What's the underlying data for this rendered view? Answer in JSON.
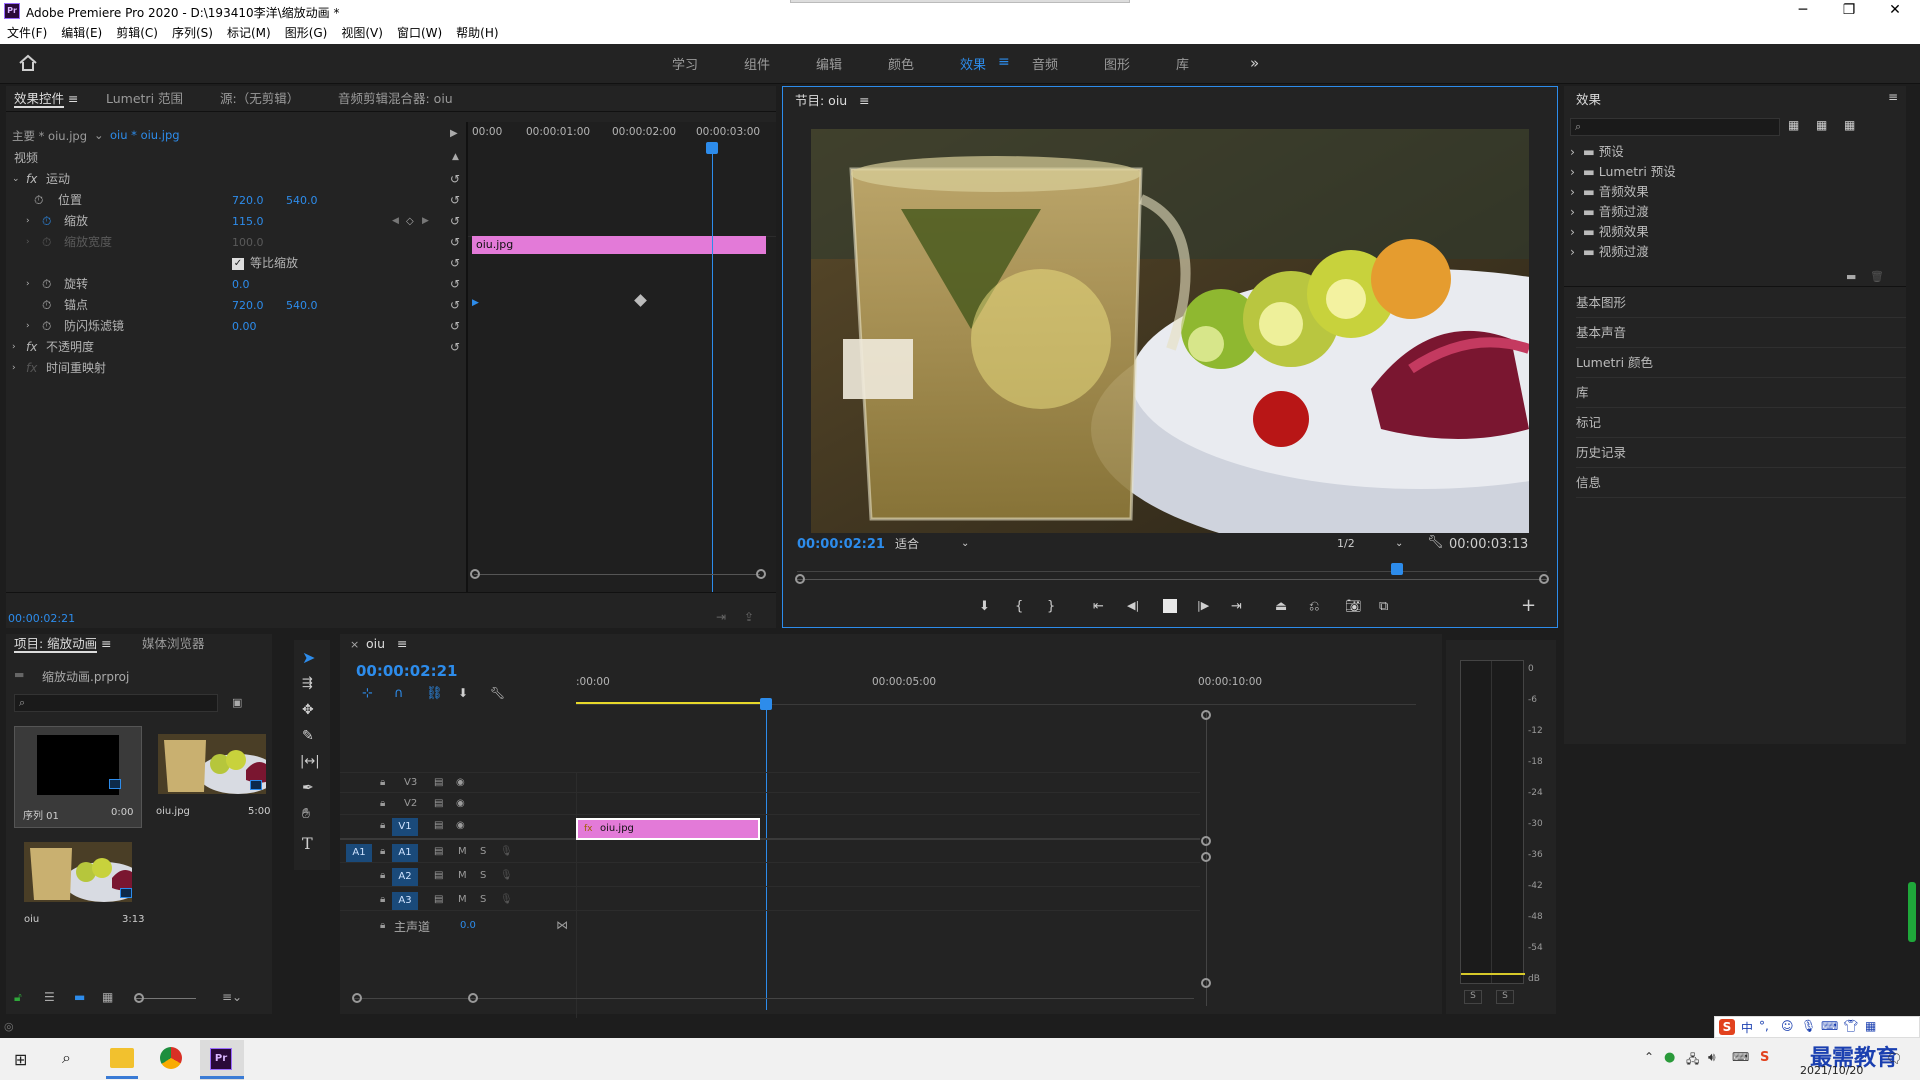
{
  "app": {
    "title": "Adobe Premiere Pro 2020 - D:\\193410李洋\\缩放动画 *",
    "icon": "Pr"
  },
  "menu": [
    "文件(F)",
    "编辑(E)",
    "剪辑(C)",
    "序列(S)",
    "标记(M)",
    "图形(G)",
    "视图(V)",
    "窗口(W)",
    "帮助(H)"
  ],
  "workspaces": [
    "学习",
    "组件",
    "编辑",
    "颜色",
    "效果",
    "音频",
    "图形",
    "库"
  ],
  "effect_controls": {
    "tabs": [
      "效果控件",
      "Lumetri 范围",
      "源:（无剪辑）",
      "音频剪辑混合器: oiu"
    ],
    "master": "主要 * oiu.jpg",
    "clip": "oiu * oiu.jpg",
    "video_label": "视频",
    "ruler": [
      "00:00",
      "00:00:01:00",
      "00:00:02:00",
      "00:00:03:00"
    ],
    "clip_bar": "oiu.jpg",
    "motion": "运动",
    "position": {
      "label": "位置",
      "x": "720.0",
      "y": "540.0"
    },
    "scale": {
      "label": "缩放",
      "value": "115.0"
    },
    "scale_width": {
      "label": "缩放宽度",
      "value": "100.0"
    },
    "uniform": "等比缩放",
    "rotation": {
      "label": "旋转",
      "value": "0.0"
    },
    "anchor": {
      "label": "锚点",
      "x": "720.0",
      "y": "540.0"
    },
    "flicker": {
      "label": "防闪烁滤镜",
      "value": "0.00"
    },
    "opacity": "不透明度",
    "timeremap": "时间重映射",
    "timecode": "00:00:02:21"
  },
  "program": {
    "tab": "节目: oiu",
    "timecode": "00:00:02:21",
    "fit": "适合",
    "res": "1/2",
    "duration": "00:00:03:13"
  },
  "effects": {
    "title": "效果",
    "tree": [
      "预设",
      "Lumetri 预设",
      "音频效果",
      "音频过渡",
      "视频效果",
      "视频过渡"
    ],
    "panels": [
      "基本图形",
      "基本声音",
      "Lumetri 颜色",
      "库",
      "标记",
      "历史记录",
      "信息"
    ]
  },
  "project": {
    "tabs": [
      "项目: 缩放动画",
      "媒体浏览器"
    ],
    "file": "缩放动画.prproj",
    "items": [
      {
        "name": "序列 01",
        "dur": "0:00"
      },
      {
        "name": "oiu.jpg",
        "dur": "5:00"
      },
      {
        "name": "oiu",
        "dur": "3:13"
      }
    ]
  },
  "timeline": {
    "tab": "oiu",
    "timecode": "00:00:02:21",
    "ruler": [
      ":00:00",
      "00:00:05:00",
      "00:00:10:00"
    ],
    "video_tracks": [
      "V3",
      "V2",
      "V1"
    ],
    "audio_tracks": [
      "A1",
      "A2",
      "A3"
    ],
    "source_patch": "A1",
    "master": "主声道",
    "master_val": "0.0",
    "clip": "oiu.jpg",
    "mute": "M",
    "solo": "S"
  },
  "meter": {
    "scale": [
      "0",
      "-6",
      "-12",
      "-18",
      "-24",
      "-30",
      "-36",
      "-42",
      "-48",
      "-54",
      "dB"
    ],
    "solo": [
      "S",
      "S"
    ]
  },
  "taskbar": {
    "ime": "中",
    "date": "2021/10/20",
    "watermark": "最需教育"
  }
}
